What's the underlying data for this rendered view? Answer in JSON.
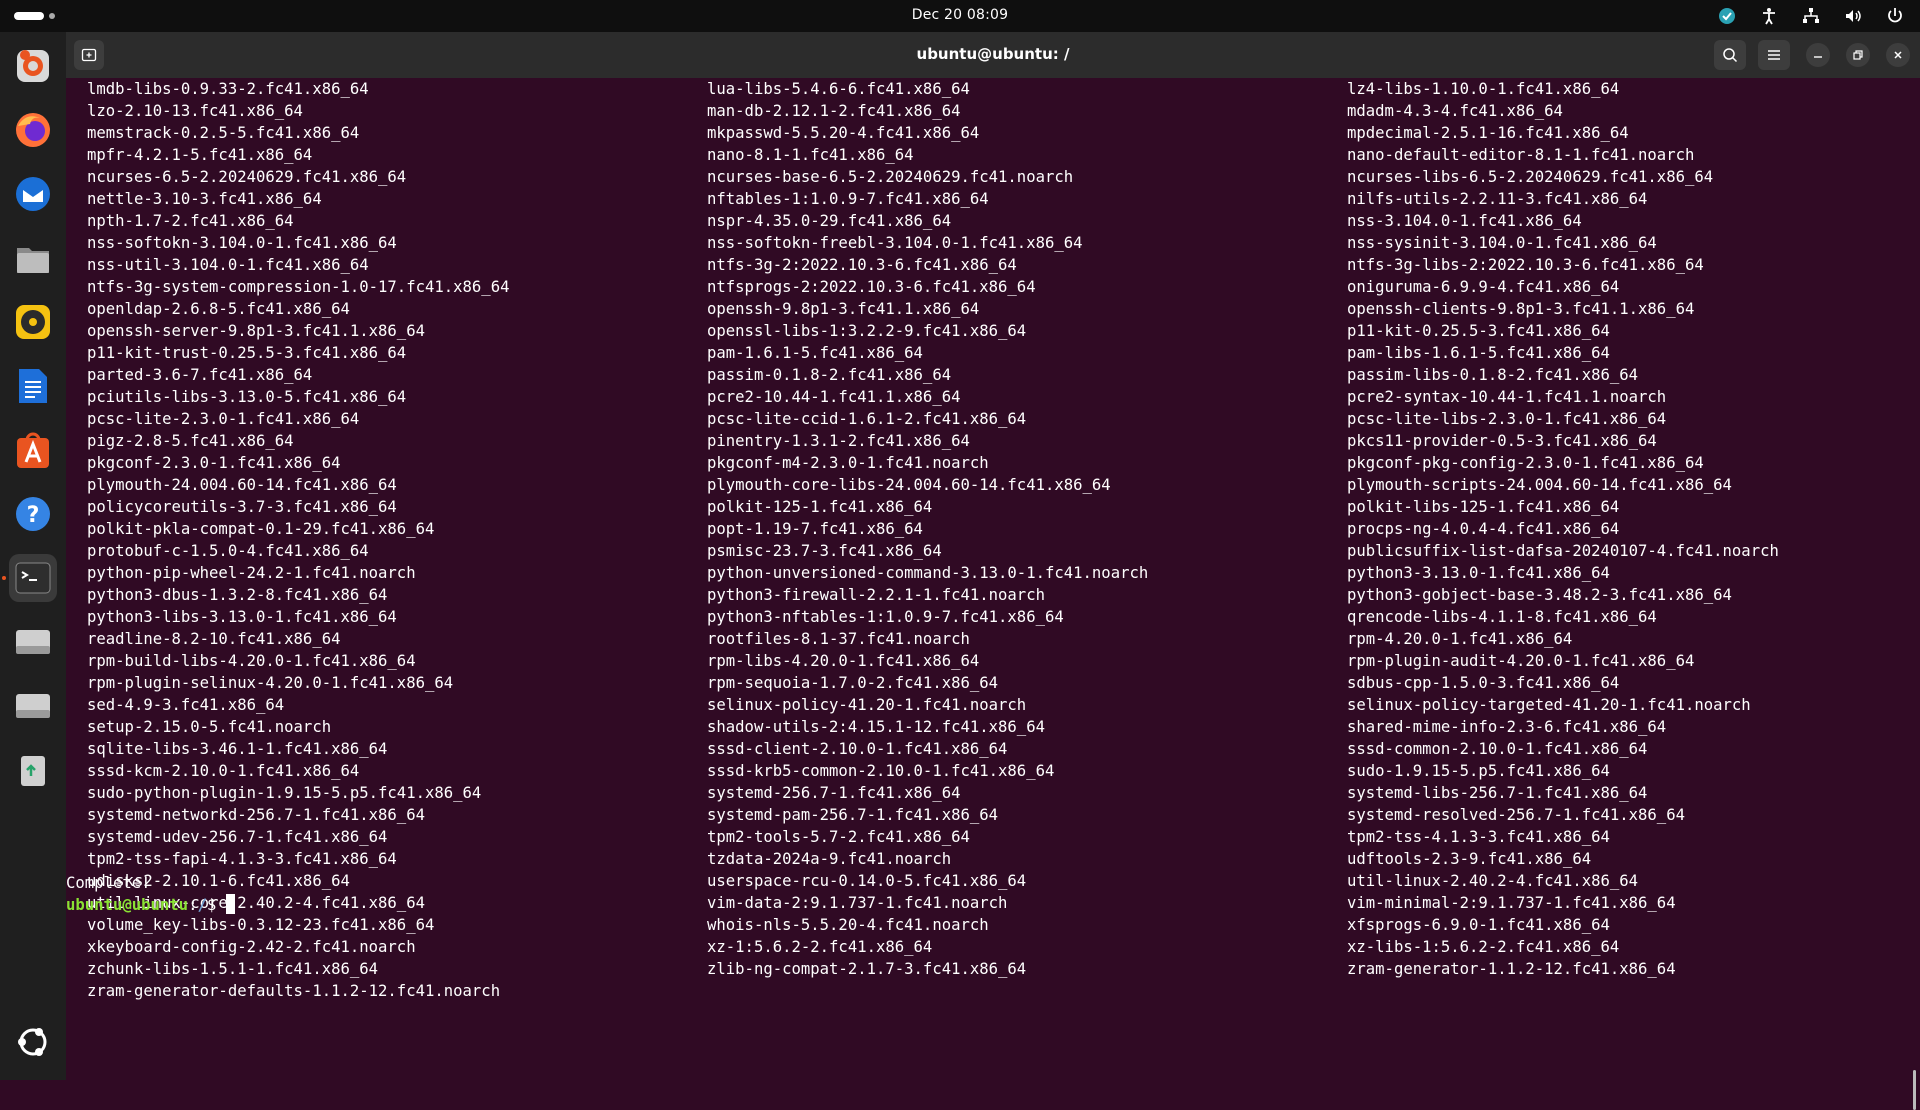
{
  "topbar": {
    "clock": "Dec 20  08:09"
  },
  "dock": {
    "items": [
      {
        "name": "ubuntu-installer-icon"
      },
      {
        "name": "firefox-icon"
      },
      {
        "name": "thunderbird-icon"
      },
      {
        "name": "files-icon"
      },
      {
        "name": "rhythmbox-icon"
      },
      {
        "name": "libreoffice-writer-icon"
      },
      {
        "name": "app-center-icon"
      },
      {
        "name": "help-icon"
      },
      {
        "name": "terminal-icon"
      },
      {
        "name": "drive-icon"
      },
      {
        "name": "drive-icon"
      },
      {
        "name": "trash-icon"
      }
    ],
    "show_apps": "ubuntu-logo-icon"
  },
  "window": {
    "title": "ubuntu@ubuntu: /"
  },
  "terminal": {
    "columns": [
      [
        "lmdb-libs-0.9.33-2.fc41.x86_64",
        "lzo-2.10-13.fc41.x86_64",
        "memstrack-0.2.5-5.fc41.x86_64",
        "mpfr-4.2.1-5.fc41.x86_64",
        "ncurses-6.5-2.20240629.fc41.x86_64",
        "nettle-3.10-3.fc41.x86_64",
        "npth-1.7-2.fc41.x86_64",
        "nss-softokn-3.104.0-1.fc41.x86_64",
        "nss-util-3.104.0-1.fc41.x86_64",
        "ntfs-3g-system-compression-1.0-17.fc41.x86_64",
        "openldap-2.6.8-5.fc41.x86_64",
        "openssh-server-9.8p1-3.fc41.1.x86_64",
        "p11-kit-trust-0.25.5-3.fc41.x86_64",
        "parted-3.6-7.fc41.x86_64",
        "pciutils-libs-3.13.0-5.fc41.x86_64",
        "pcsc-lite-2.3.0-1.fc41.x86_64",
        "pigz-2.8-5.fc41.x86_64",
        "pkgconf-2.3.0-1.fc41.x86_64",
        "plymouth-24.004.60-14.fc41.x86_64",
        "policycoreutils-3.7-3.fc41.x86_64",
        "polkit-pkla-compat-0.1-29.fc41.x86_64",
        "protobuf-c-1.5.0-4.fc41.x86_64",
        "python-pip-wheel-24.2-1.fc41.noarch",
        "python3-dbus-1.3.2-8.fc41.x86_64",
        "python3-libs-3.13.0-1.fc41.x86_64",
        "readline-8.2-10.fc41.x86_64",
        "rpm-build-libs-4.20.0-1.fc41.x86_64",
        "rpm-plugin-selinux-4.20.0-1.fc41.x86_64",
        "sed-4.9-3.fc41.x86_64",
        "setup-2.15.0-5.fc41.noarch",
        "sqlite-libs-3.46.1-1.fc41.x86_64",
        "sssd-kcm-2.10.0-1.fc41.x86_64",
        "sudo-python-plugin-1.9.15-5.p5.fc41.x86_64",
        "systemd-networkd-256.7-1.fc41.x86_64",
        "systemd-udev-256.7-1.fc41.x86_64",
        "tpm2-tss-fapi-4.1.3-3.fc41.x86_64",
        "udisks2-2.10.1-6.fc41.x86_64",
        "util-linux-core-2.40.2-4.fc41.x86_64",
        "volume_key-libs-0.3.12-23.fc41.x86_64",
        "xkeyboard-config-2.42-2.fc41.noarch",
        "zchunk-libs-1.5.1-1.fc41.x86_64",
        "zram-generator-defaults-1.1.2-12.fc41.noarch"
      ],
      [
        "lua-libs-5.4.6-6.fc41.x86_64",
        "man-db-2.12.1-2.fc41.x86_64",
        "mkpasswd-5.5.20-4.fc41.x86_64",
        "nano-8.1-1.fc41.x86_64",
        "ncurses-base-6.5-2.20240629.fc41.noarch",
        "nftables-1:1.0.9-7.fc41.x86_64",
        "nspr-4.35.0-29.fc41.x86_64",
        "nss-softokn-freebl-3.104.0-1.fc41.x86_64",
        "ntfs-3g-2:2022.10.3-6.fc41.x86_64",
        "ntfsprogs-2:2022.10.3-6.fc41.x86_64",
        "openssh-9.8p1-3.fc41.1.x86_64",
        "openssl-libs-1:3.2.2-9.fc41.x86_64",
        "pam-1.6.1-5.fc41.x86_64",
        "passim-0.1.8-2.fc41.x86_64",
        "pcre2-10.44-1.fc41.1.x86_64",
        "pcsc-lite-ccid-1.6.1-2.fc41.x86_64",
        "pinentry-1.3.1-2.fc41.x86_64",
        "pkgconf-m4-2.3.0-1.fc41.noarch",
        "plymouth-core-libs-24.004.60-14.fc41.x86_64",
        "polkit-125-1.fc41.x86_64",
        "popt-1.19-7.fc41.x86_64",
        "psmisc-23.7-3.fc41.x86_64",
        "python-unversioned-command-3.13.0-1.fc41.noarch",
        "python3-firewall-2.2.1-1.fc41.noarch",
        "python3-nftables-1:1.0.9-7.fc41.x86_64",
        "rootfiles-8.1-37.fc41.noarch",
        "rpm-libs-4.20.0-1.fc41.x86_64",
        "rpm-sequoia-1.7.0-2.fc41.x86_64",
        "selinux-policy-41.20-1.fc41.noarch",
        "shadow-utils-2:4.15.1-12.fc41.x86_64",
        "sssd-client-2.10.0-1.fc41.x86_64",
        "sssd-krb5-common-2.10.0-1.fc41.x86_64",
        "systemd-256.7-1.fc41.x86_64",
        "systemd-pam-256.7-1.fc41.x86_64",
        "tpm2-tools-5.7-2.fc41.x86_64",
        "tzdata-2024a-9.fc41.noarch",
        "userspace-rcu-0.14.0-5.fc41.x86_64",
        "vim-data-2:9.1.737-1.fc41.noarch",
        "whois-nls-5.5.20-4.fc41.noarch",
        "xz-1:5.6.2-2.fc41.x86_64",
        "zlib-ng-compat-2.1.7-3.fc41.x86_64"
      ],
      [
        "lz4-libs-1.10.0-1.fc41.x86_64",
        "mdadm-4.3-4.fc41.x86_64",
        "mpdecimal-2.5.1-16.fc41.x86_64",
        "nano-default-editor-8.1-1.fc41.noarch",
        "ncurses-libs-6.5-2.20240629.fc41.x86_64",
        "nilfs-utils-2.2.11-3.fc41.x86_64",
        "nss-3.104.0-1.fc41.x86_64",
        "nss-sysinit-3.104.0-1.fc41.x86_64",
        "ntfs-3g-libs-2:2022.10.3-6.fc41.x86_64",
        "oniguruma-6.9.9-4.fc41.x86_64",
        "openssh-clients-9.8p1-3.fc41.1.x86_64",
        "p11-kit-0.25.5-3.fc41.x86_64",
        "pam-libs-1.6.1-5.fc41.x86_64",
        "passim-libs-0.1.8-2.fc41.x86_64",
        "pcre2-syntax-10.44-1.fc41.1.noarch",
        "pcsc-lite-libs-2.3.0-1.fc41.x86_64",
        "pkcs11-provider-0.5-3.fc41.x86_64",
        "pkgconf-pkg-config-2.3.0-1.fc41.x86_64",
        "plymouth-scripts-24.004.60-14.fc41.x86_64",
        "polkit-libs-125-1.fc41.x86_64",
        "procps-ng-4.0.4-4.fc41.x86_64",
        "publicsuffix-list-dafsa-20240107-4.fc41.noarch",
        "python3-3.13.0-1.fc41.x86_64",
        "python3-gobject-base-3.48.2-3.fc41.x86_64",
        "qrencode-libs-4.1.1-8.fc41.x86_64",
        "rpm-4.20.0-1.fc41.x86_64",
        "rpm-plugin-audit-4.20.0-1.fc41.x86_64",
        "sdbus-cpp-1.5.0-3.fc41.x86_64",
        "selinux-policy-targeted-41.20-1.fc41.noarch",
        "shared-mime-info-2.3-6.fc41.x86_64",
        "sssd-common-2.10.0-1.fc41.x86_64",
        "sudo-1.9.15-5.p5.fc41.x86_64",
        "systemd-libs-256.7-1.fc41.x86_64",
        "systemd-resolved-256.7-1.fc41.x86_64",
        "tpm2-tss-4.1.3-3.fc41.x86_64",
        "udftools-2.3-9.fc41.x86_64",
        "util-linux-2.40.2-4.fc41.x86_64",
        "vim-minimal-2:9.1.737-1.fc41.x86_64",
        "xfsprogs-6.9.0-1.fc41.x86_64",
        "xz-libs-1:5.6.2-2.fc41.x86_64",
        "zram-generator-1.1.2-12.fc41.x86_64"
      ]
    ],
    "complete_text": "Complete!",
    "prompt_user": "ubuntu@ubuntu",
    "prompt_sep": ":",
    "prompt_path": "/",
    "prompt_symbol": "$ "
  },
  "colors": {
    "terminal_bg": "#300a24",
    "prompt_user": "#8ae234",
    "prompt_path": "#729fcf",
    "accent": "#e95420"
  }
}
